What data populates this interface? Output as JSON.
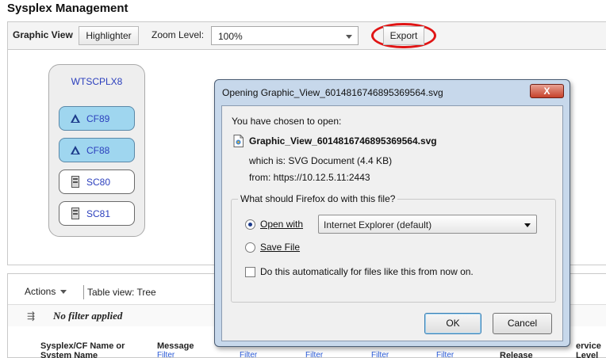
{
  "page": {
    "title": "Sysplex Management"
  },
  "toolbar": {
    "graphic_view_label": "Graphic View",
    "highlighter_label": "Highlighter",
    "zoom_label": "Zoom Level:",
    "zoom_value": "100%",
    "export_label": "Export"
  },
  "graphic": {
    "sysplex_name": "WTSCPLX8",
    "nodes": [
      {
        "name": "CF89",
        "kind": "coupling-facility"
      },
      {
        "name": "CF88",
        "kind": "coupling-facility"
      },
      {
        "name": "SC80",
        "kind": "system"
      },
      {
        "name": "SC81",
        "kind": "system"
      }
    ]
  },
  "table_panel": {
    "actions_label": "Actions",
    "table_view": "Table view: Tree",
    "filter_status": "No filter applied",
    "columns": [
      {
        "header": "Sysplex/CF Name or System Name",
        "filter": ""
      },
      {
        "header": "Message",
        "filter": "Filter"
      },
      {
        "header": "",
        "filter": "Filter"
      },
      {
        "header": "",
        "filter": "Filter"
      },
      {
        "header": "",
        "filter": "Filter"
      },
      {
        "header": "",
        "filter": "Filter"
      },
      {
        "header": "Release",
        "filter": ""
      },
      {
        "header": "ervice Level",
        "filter": ""
      }
    ]
  },
  "dialog": {
    "title": "Opening Graphic_View_6014816746895369564.svg",
    "close_label": "X",
    "intro": "You have chosen to open:",
    "file_name": "Graphic_View_6014816746895369564.svg",
    "which_is": "which is:  SVG Document (4.4 KB)",
    "from": "from:  https://10.12.5.11:2443",
    "question": "What should Firefox do with this file?",
    "open_with_label": "Open with",
    "open_with_app": "Internet Explorer (default)",
    "save_file_label": "Save File",
    "auto_label": "Do this automatically for files like this from now on.",
    "ok_label": "OK",
    "cancel_label": "Cancel",
    "selected_option": "open_with"
  },
  "colors": {
    "export_highlight": "#e01515",
    "node_link": "#2b3fbd",
    "cf_node_fill": "#9fd6ef",
    "dialog_frame": "#c7d8eb"
  }
}
